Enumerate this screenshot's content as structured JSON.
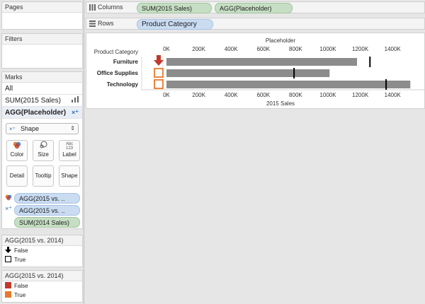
{
  "left_panel": {
    "pages": {
      "title": "Pages"
    },
    "filters": {
      "title": "Filters"
    },
    "marks": {
      "title": "Marks",
      "rows": [
        {
          "label": "All"
        },
        {
          "label": "SUM(2015 Sales)",
          "icon": "bar-chart-icon"
        },
        {
          "label": "AGG(Placeholder)",
          "icon": "shape-icon"
        }
      ],
      "mark_type": "Shape",
      "buttons": {
        "color": "Color",
        "size": "Size",
        "label": "Label",
        "detail": "Detail",
        "tooltip": "Tooltip",
        "shape": "Shape"
      },
      "label_icon_text": "Abc\n123",
      "fields": [
        {
          "label": "AGG(2015 vs. ..",
          "icon": "color-icon",
          "kind": "blue"
        },
        {
          "label": "AGG(2015 vs. ..",
          "icon": "shape-icon",
          "kind": "blue"
        },
        {
          "label": "SUM(2014 Sales)",
          "icon": "",
          "kind": "green"
        }
      ]
    },
    "shape_legend": {
      "title": "AGG(2015 vs. 2014)",
      "items": [
        {
          "label": "False",
          "icon": "down-arrow-icon"
        },
        {
          "label": "True",
          "icon": "square-outline-icon"
        }
      ]
    },
    "color_legend": {
      "title": "AGG(2015 vs. 2014)",
      "items": [
        {
          "label": "False",
          "color": "#c0392b"
        },
        {
          "label": "True",
          "color": "#e8782c"
        }
      ]
    }
  },
  "shelves": {
    "columns": {
      "label": "Columns",
      "pills": [
        "SUM(2015 Sales)",
        "AGG(Placeholder)"
      ]
    },
    "rows": {
      "label": "Rows",
      "pills": [
        "Product Category"
      ]
    }
  },
  "chart_data": {
    "type": "bar",
    "row_header": "Product Category",
    "categories": [
      "Furniture",
      "Office Supplies",
      "Technology"
    ],
    "values": [
      1180000,
      1010000,
      1510000
    ],
    "reference_values": [
      1260000,
      790000,
      1360000
    ],
    "xlabel": "2015 Sales",
    "top_axis_title": "Placeholder",
    "ticks": [
      "0K",
      "200K",
      "400K",
      "600K",
      "800K",
      "1000K",
      "1200K",
      "1400K"
    ],
    "xlim": [
      0,
      1550000
    ],
    "placeholder_shapes": [
      "down-arrow-icon",
      "square-outline-icon",
      "square-outline-icon"
    ],
    "placeholder_colors": [
      "#c0392b",
      "#e8782c",
      "#e8782c"
    ],
    "bar_color": "#8c8c8c",
    "reference_color": "#000000"
  }
}
